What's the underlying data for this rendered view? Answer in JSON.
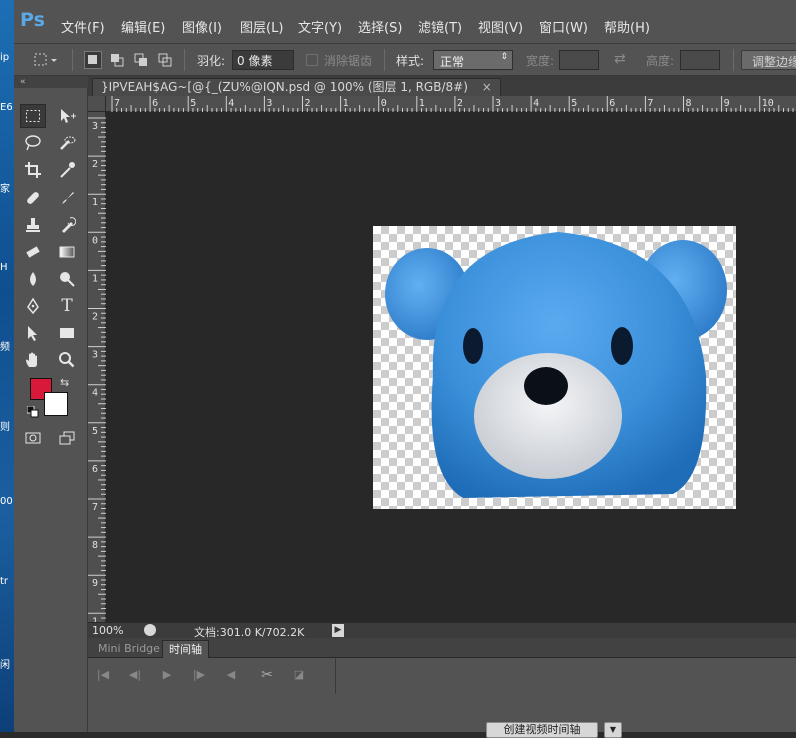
{
  "desktop": {
    "labels": [
      {
        "text": "ip"
      },
      {
        "text": "E6"
      },
      {
        "text": "家"
      },
      {
        "text": "H"
      },
      {
        "text": "频"
      },
      {
        "text": "则"
      },
      {
        "text": "00"
      },
      {
        "text": "tr"
      },
      {
        "text": "闲"
      }
    ]
  },
  "app": {
    "logo": "Ps",
    "menus": [
      {
        "label": "文件(F)"
      },
      {
        "label": "编辑(E)"
      },
      {
        "label": "图像(I)"
      },
      {
        "label": "图层(L)"
      },
      {
        "label": "文字(Y)"
      },
      {
        "label": "选择(S)"
      },
      {
        "label": "滤镜(T)"
      },
      {
        "label": "视图(V)"
      },
      {
        "label": "窗口(W)"
      },
      {
        "label": "帮助(H)"
      }
    ]
  },
  "options_bar": {
    "feather_label": "羽化:",
    "feather_value": "0 像素",
    "antialias_label": "消除锯齿",
    "style_label": "样式:",
    "style_value": "正常",
    "width_label": "宽度:",
    "height_label": "高度:",
    "refine_edge_label": "调整边缘"
  },
  "document": {
    "tab_title": "}IPVEAH$AG~[@{_(ZU%@IQN.psd @ 100% (图层 1, RGB/8#)",
    "close_symbol": "×",
    "hruler_labels": [
      "7",
      "6",
      "5",
      "4",
      "3",
      "2",
      "1",
      "0",
      "1",
      "2",
      "3",
      "4",
      "5",
      "6",
      "7",
      "8",
      "9",
      "10"
    ],
    "vruler_labels": [
      "3",
      "2",
      "1",
      "0",
      "1",
      "2",
      "3",
      "4",
      "5",
      "6",
      "7",
      "8",
      "9",
      "1"
    ]
  },
  "colors": {
    "foreground": "#d8193a",
    "background": "#ffffff",
    "bear_blue": "#3a8fd9"
  },
  "status_bar": {
    "zoom": "100%",
    "doc_size": "文档:301.0 K/702.2K"
  },
  "bottom_panel": {
    "tabs": [
      {
        "label": "Mini Bridge",
        "active": false
      },
      {
        "label": "时间轴",
        "active": true
      }
    ],
    "create_video_label": "创建视频时间轴"
  }
}
